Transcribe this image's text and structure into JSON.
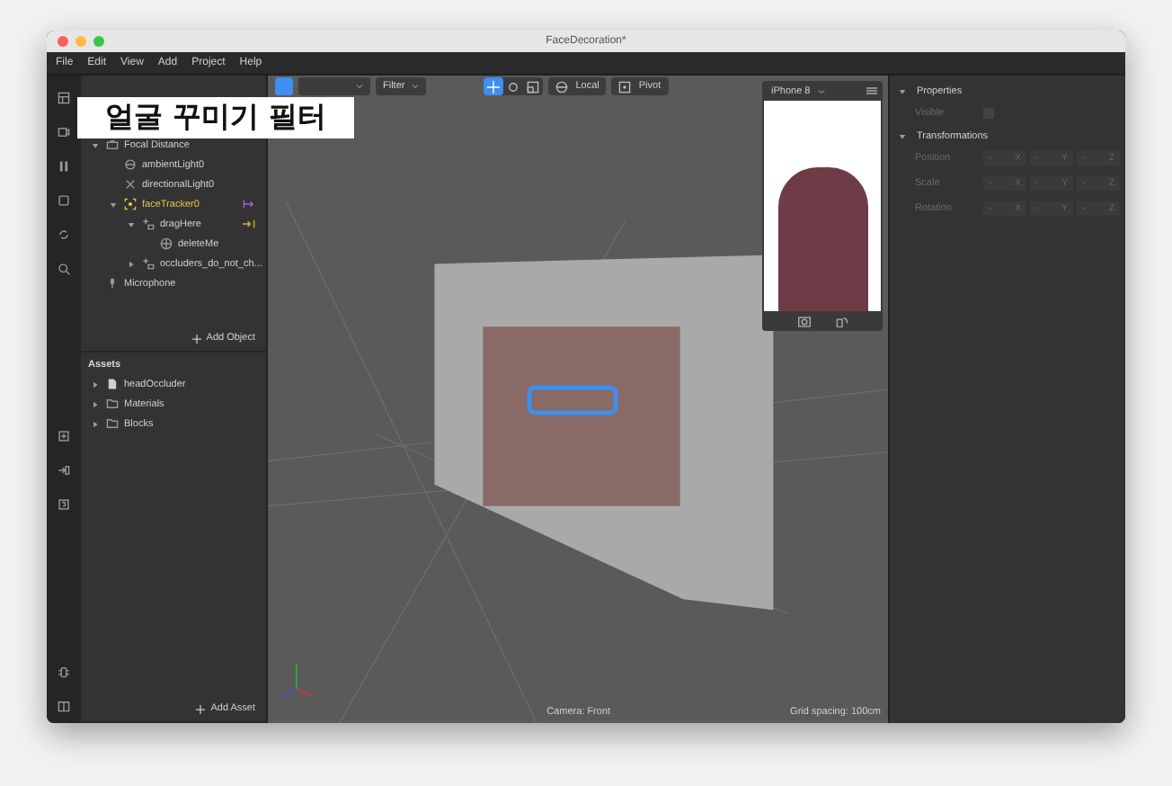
{
  "window": {
    "title": "FaceDecoration*",
    "caption": "얼굴 꾸미기 필터"
  },
  "menu": [
    "File",
    "Edit",
    "View",
    "Add",
    "Project",
    "Help"
  ],
  "scene": {
    "items": [
      {
        "label": "Focal Distance",
        "kind": "camera",
        "expanded": true,
        "selected": false,
        "children": [
          {
            "label": "ambientLight0",
            "kind": "light",
            "selected": false
          },
          {
            "label": "directionalLight0",
            "kind": "dirlight",
            "selected": false
          },
          {
            "label": "faceTracker0",
            "kind": "tracker",
            "expanded": true,
            "selected": true,
            "children": [
              {
                "label": "dragHere",
                "kind": "null",
                "expanded": true,
                "selected": false,
                "children": [
                  {
                    "label": "deleteMe",
                    "kind": "mesh",
                    "selected": false
                  }
                ]
              },
              {
                "label": "occluders_do_not_ch...",
                "kind": "null",
                "expanded": false,
                "selected": false
              }
            ]
          }
        ]
      },
      {
        "label": "Microphone",
        "kind": "mic",
        "selected": false
      }
    ],
    "add_button": "Add Object"
  },
  "assets": {
    "title": "Assets",
    "items": [
      {
        "label": "headOccluder",
        "kind": "file",
        "expanded": false
      },
      {
        "label": "Materials",
        "kind": "folder",
        "expanded": false
      },
      {
        "label": "Blocks",
        "kind": "folder",
        "expanded": false
      }
    ],
    "add_button": "Add Asset"
  },
  "toolbar": {
    "filter": "Filter",
    "tools": [
      {
        "kind": "move",
        "selected": true
      },
      {
        "kind": "rotate",
        "selected": false
      },
      {
        "kind": "scale",
        "selected": false
      }
    ],
    "local": "Local",
    "pivot": "Pivot"
  },
  "preview": {
    "device": "iPhone 8"
  },
  "status": {
    "camera": "Camera: Front",
    "grid": "Grid spacing: 100cm"
  },
  "properties": {
    "title": "Properties",
    "visible_label": "Visible",
    "visible": false,
    "transform_title": "Transformations",
    "rows": [
      {
        "label": "Position",
        "fields": [
          {
            "value": "-",
            "axis": "X"
          },
          {
            "value": "-",
            "axis": "Y"
          },
          {
            "value": "-",
            "axis": "Z"
          }
        ]
      },
      {
        "label": "Scale",
        "fields": [
          {
            "value": "-",
            "axis": "X"
          },
          {
            "value": "-",
            "axis": "Y"
          },
          {
            "value": "-",
            "axis": "Z"
          }
        ]
      },
      {
        "label": "Rotation",
        "fields": [
          {
            "value": "-",
            "axis": "X"
          },
          {
            "value": "-",
            "axis": "Y"
          },
          {
            "value": "-",
            "axis": "Z"
          }
        ]
      }
    ]
  }
}
